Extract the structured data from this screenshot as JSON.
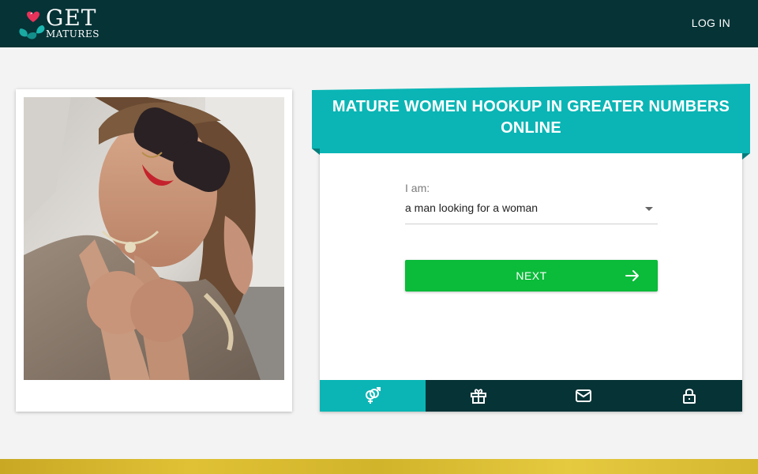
{
  "header": {
    "logo": {
      "line1": "GET",
      "line2": "MATURES"
    },
    "login_label": "LOG IN"
  },
  "signup": {
    "title": "MATURE WOMEN HOOKUP IN GREATER NUMBERS ONLINE",
    "iam_label": "I am:",
    "selected_option": "a man looking for a woman",
    "next_label": "NEXT"
  },
  "steps": [
    {
      "icon": "gender-icon",
      "active": true
    },
    {
      "icon": "gift-icon",
      "active": false
    },
    {
      "icon": "mail-icon",
      "active": false
    },
    {
      "icon": "lock-icon",
      "active": false
    }
  ],
  "colors": {
    "header_bg": "#063336",
    "accent_teal": "#0bb5b5",
    "button_green": "#0bbb3a",
    "page_bg": "#f3f3f3"
  }
}
